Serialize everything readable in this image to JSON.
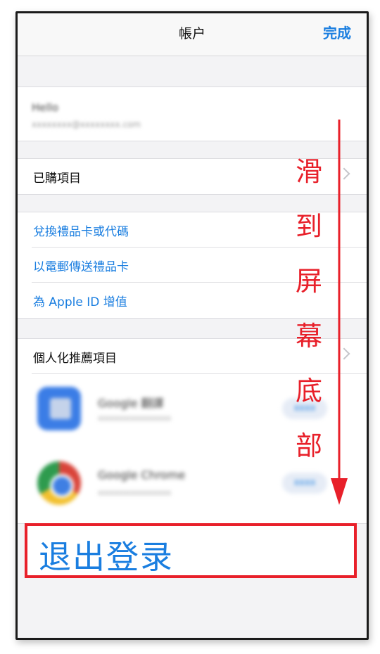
{
  "navbar": {
    "title": "帳户",
    "done_label": "完成"
  },
  "account": {
    "name": "Hello",
    "email": "xxxxxxxx@xxxxxxxx.com"
  },
  "rows": {
    "purchased": "已購項目",
    "redeem": "兌換禮品卡或代碼",
    "send_gift": "以電郵傳送禮品卡",
    "add_funds": "為 Apple ID 增值",
    "personalized": "個人化推薦項目"
  },
  "apps": [
    {
      "name": "Google 翻譯",
      "sub": "xxxxxxxxxxxxxxxx",
      "button": "xxxx",
      "icon": "google-translate-icon"
    },
    {
      "name": "Google Chrome",
      "sub": "xxxxxxxxxxxxxxxx",
      "button": "xxxx",
      "icon": "google-chrome-icon"
    }
  ],
  "logout": {
    "label": "退出登录"
  },
  "annotation": {
    "chars": [
      "滑",
      "到",
      "屏",
      "幕",
      "底",
      "部"
    ],
    "color": "#e8202a"
  },
  "colors": {
    "link": "#1a7ee0",
    "highlight": "#e8202a"
  }
}
